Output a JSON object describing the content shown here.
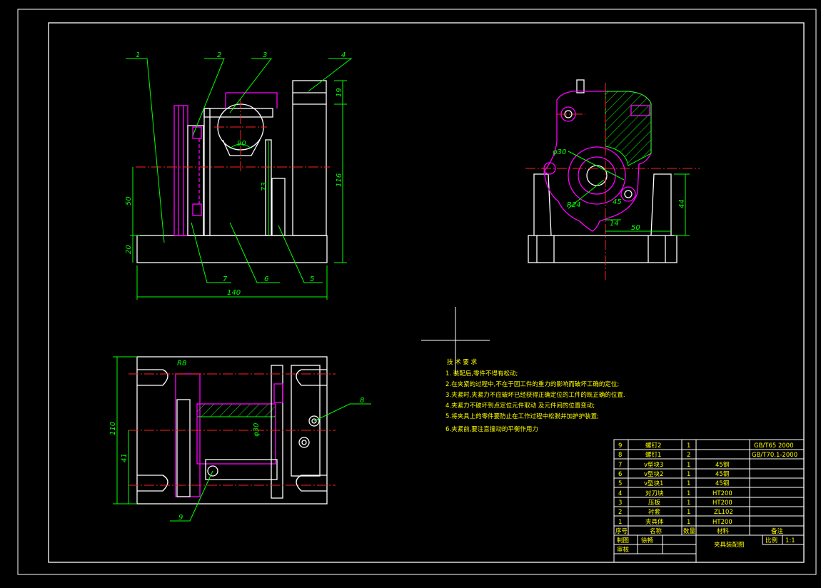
{
  "balloons": {
    "b1": "1",
    "b2": "2",
    "b3": "3",
    "b4": "4",
    "b5": "5",
    "b6": "6",
    "b7": "7",
    "b8": "8",
    "b9": "9"
  },
  "dimensions": {
    "d140": "140",
    "d116": "116",
    "d73": "73",
    "d50": "50",
    "d20": "20",
    "d19": "19",
    "d90": "90",
    "d110": "110",
    "d41": "41",
    "dR8": "R8",
    "dphi30_top": "φ30",
    "dphi30_bottom": "φ30",
    "dR24": "R24",
    "d45": "45",
    "d14": "14",
    "d50_side": "50",
    "d44": "44"
  },
  "tech_requirements": {
    "title": "技 术 要 求",
    "lines": [
      "1. 装配后,零件不得有松动;",
      "2.在夹紧的过程中,不在于因工件的重力的影响而破坏工确的定位;",
      "3.夹紧时,夹紧力不应破坏已经获得正确定位的工件的既正确的位置.",
      "4.夹紧力不破坏到点定位元件取动 及元件间的位置变动;",
      "5.将夹具上的零件要防止在工作过程中松脱并加护护装置;",
      "6.夹紧前,要注意撞动的平衡作用力"
    ]
  },
  "parts_list": {
    "rows": [
      {
        "no": "9",
        "name": "螺钉2",
        "qty": "1",
        "material": "",
        "note": "GB/T65 2000"
      },
      {
        "no": "8",
        "name": "螺钉1",
        "qty": "2",
        "material": "",
        "note": "GB/T70.1-2000"
      },
      {
        "no": "7",
        "name": "v型块3",
        "qty": "1",
        "material": "45钢",
        "note": ""
      },
      {
        "no": "6",
        "name": "v型块2",
        "qty": "1",
        "material": "45钢",
        "note": ""
      },
      {
        "no": "5",
        "name": "v型块1",
        "qty": "1",
        "material": "45钢",
        "note": ""
      },
      {
        "no": "4",
        "name": "对刀块",
        "qty": "1",
        "material": "HT200",
        "note": ""
      },
      {
        "no": "3",
        "name": "压板",
        "qty": "1",
        "material": "HT200",
        "note": ""
      },
      {
        "no": "2",
        "name": "衬套",
        "qty": "1",
        "material": "ZL102",
        "note": ""
      },
      {
        "no": "1",
        "name": "夹具体",
        "qty": "1",
        "material": "HT200",
        "note": ""
      }
    ],
    "header": {
      "no": "序号",
      "name": "名称",
      "qty": "数量",
      "material": "材料",
      "note": "备注"
    }
  },
  "title_block": {
    "drawn_label": "制图",
    "drawn_value": "徐畅",
    "check_label": "审核",
    "drawing_title": "夹具装配图",
    "scale_label": "比例",
    "scale_value": "1:1"
  },
  "colors": {
    "outline": "#ffffff",
    "part": "#ff00ff",
    "center": "#ff2020",
    "dimension": "#00ff00",
    "text": "#ffff00",
    "background": "#000000"
  }
}
